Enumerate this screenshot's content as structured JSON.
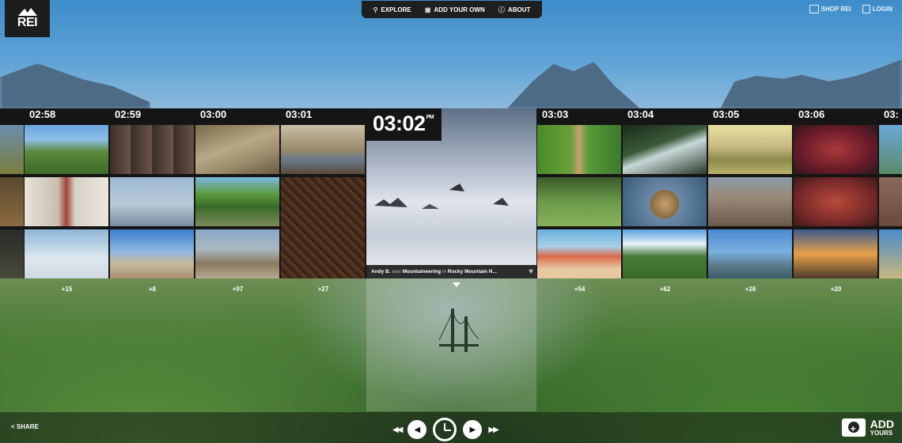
{
  "brand": {
    "logo_text": "REI"
  },
  "topnav": {
    "items": [
      {
        "label": "EXPLORE",
        "icon": "search-icon"
      },
      {
        "label": "ADD YOUR OWN",
        "icon": "camera-icon"
      },
      {
        "label": "ABOUT",
        "icon": "info-icon"
      }
    ]
  },
  "topright": {
    "shop_label": "SHOP REI",
    "login_label": "LOGIN"
  },
  "timeline": {
    "columns": [
      {
        "time": "",
        "count": ""
      },
      {
        "time": "02:58",
        "count": "+15"
      },
      {
        "time": "02:59",
        "count": "+8"
      },
      {
        "time": "03:00",
        "count": "+97"
      },
      {
        "time": "03:01",
        "count": "+27"
      },
      {
        "time": "03:03",
        "count": "+54"
      },
      {
        "time": "03:04",
        "count": "+62"
      },
      {
        "time": "03:05",
        "count": "+26"
      },
      {
        "time": "03:06",
        "count": "+20"
      },
      {
        "time": "03:",
        "count": ""
      }
    ],
    "featured": {
      "time": "03:02",
      "ampm": "PM",
      "user": "Andy B.",
      "verb": " was ",
      "activity": "Mountaineering",
      "prep": " in ",
      "location": "Rocky Mountain N..."
    }
  },
  "bottom": {
    "share_label": "SHARE",
    "add_line1": "ADD",
    "add_line2": "YOURS"
  },
  "colors": {
    "bar": "#151515",
    "sky": "#4f98d0",
    "forest": "#3f6e2e"
  }
}
